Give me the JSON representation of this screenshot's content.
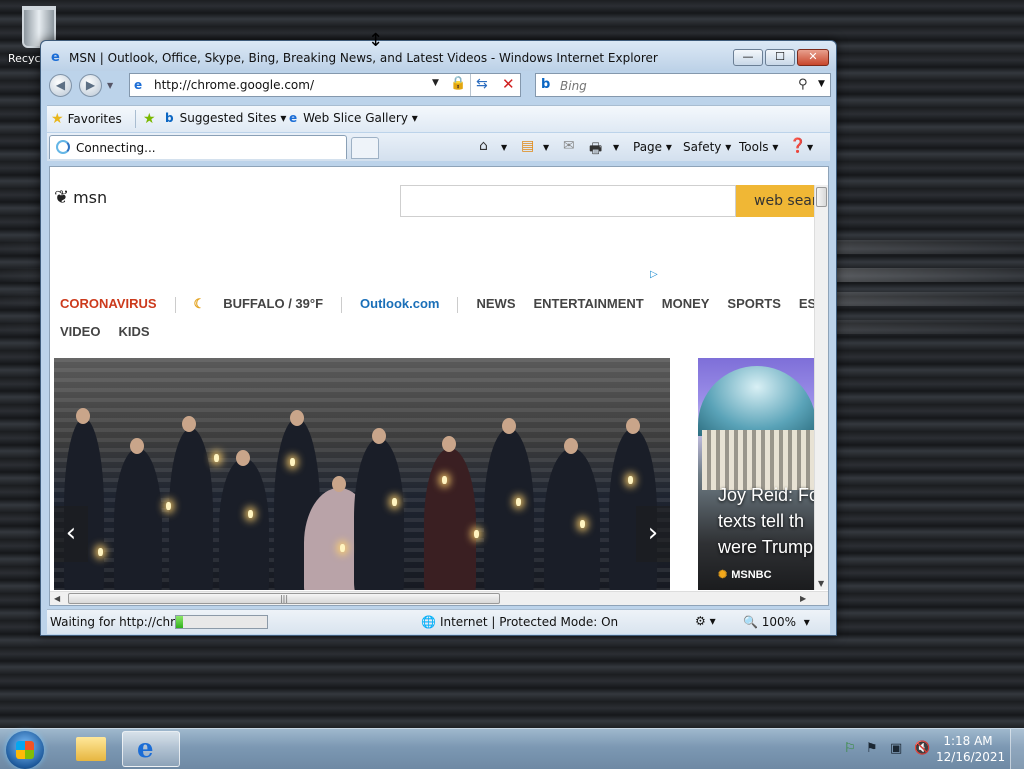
{
  "desktop": {
    "recycle_bin_label": "Recyc"
  },
  "window": {
    "title": "MSN | Outlook, Office, Skype, Bing, Breaking News, and Latest Videos - Windows Internet Explorer",
    "minimize": "—",
    "maximize": "☐",
    "close": "✕"
  },
  "navbar": {
    "address": "http://chrome.google.com/",
    "search_placeholder": "Bing"
  },
  "favorites_bar": {
    "favorites": "Favorites",
    "suggested_sites": "Suggested Sites",
    "web_slice_gallery": "Web Slice Gallery"
  },
  "tab": {
    "label": "Connecting..."
  },
  "command_bar": {
    "page": "Page",
    "safety": "Safety",
    "tools": "Tools"
  },
  "page": {
    "logo_text": "msn",
    "search_button": "web search",
    "nav_row1": {
      "coronavirus": "CORONAVIRUS",
      "weather": "BUFFALO / 39°F",
      "outlook": "Outlook.com",
      "news": "NEWS",
      "entertainment": "ENTERTAINMENT",
      "money": "MONEY",
      "sports": "SPORTS",
      "esports": "ESPORTS"
    },
    "nav_row2": {
      "video": "VIDEO",
      "kids": "KIDS"
    },
    "side_story": {
      "line1": "Joy Reid: Fo",
      "line2": "texts tell th",
      "line3": "were Trump p",
      "source": "MSNBC"
    }
  },
  "status_bar": {
    "text": "Waiting for http://chro",
    "progress": 0.08,
    "zone": "Internet | Protected Mode: On",
    "zoom": "100%"
  },
  "taskbar": {
    "time": "1:18 AM",
    "date": "12/16/2021"
  },
  "colors": {
    "accent": "#1b6dd6",
    "web_search_button": "#f0b735",
    "coronavirus_red": "#cc3a1c",
    "outlook_blue": "#1a6fb8"
  },
  "icons": [
    "recycle-bin-icon",
    "ie-icon",
    "lock-icon",
    "refresh-icon",
    "stop-icon",
    "bing-icon",
    "search-icon",
    "favorites-star-icon",
    "home-icon",
    "feeds-icon",
    "mail-icon",
    "print-icon",
    "help-icon",
    "globe-icon",
    "zoom-icon",
    "start-orb-icon",
    "folder-icon",
    "network-icon",
    "flag-icon",
    "volume-icon"
  ]
}
